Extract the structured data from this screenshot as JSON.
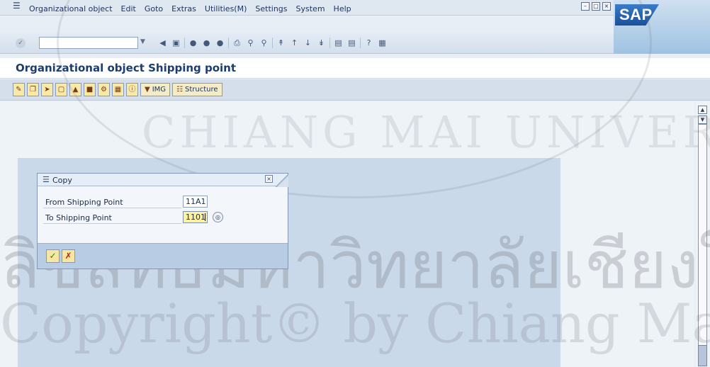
{
  "menubar": {
    "items": [
      "Organizational object",
      "Edit",
      "Goto",
      "Extras",
      "Utilities(M)",
      "Settings",
      "System",
      "Help"
    ]
  },
  "logo": {
    "text": "SAP"
  },
  "page": {
    "title": "Organizational object Shipping point"
  },
  "app_toolbar": {
    "img_label": "IMG",
    "structure_label": "Structure"
  },
  "dialog": {
    "title": "Copy",
    "from_label": "From Shipping Point",
    "from_value": "11A1",
    "to_label": "To Shipping Point",
    "to_value": "1101"
  },
  "watermark": {
    "line1": "ลิขสิทธิ์มหาวิทยาลัยเชียงใหม่",
    "line2": "Copyright© by Chiang Mai University",
    "arc_text": "CHIANG MAI UNIVERSITY"
  },
  "icons": {
    "enter": "enter-checkmark-icon",
    "save": "save-icon",
    "back": "back-icon",
    "exit": "exit-icon",
    "cancel": "cancel-icon",
    "print": "print-icon",
    "find": "find-icon"
  },
  "colors": {
    "title_text": "#1c3d70",
    "active_field": "#fef2a1",
    "dialog_footer": "#b8cce3",
    "work_panel": "#c9d9ea"
  }
}
